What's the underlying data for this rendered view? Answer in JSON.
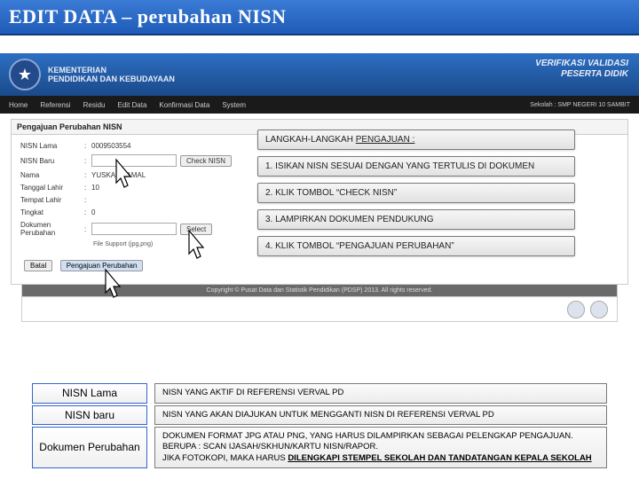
{
  "slide_title": "EDIT DATA – perubahan NISN",
  "gov": {
    "line1": "KEMENTERIAN",
    "line2": "PENDIDIKAN DAN KEBUDAYAAN",
    "verif1": "VERIFIKASI VALIDASI",
    "verif2": "PESERTA DIDIK"
  },
  "nav": {
    "items": [
      "Home",
      "Referensi",
      "Residu",
      "Edit Data",
      "Konfirmasi Data",
      "System"
    ],
    "sekolah": "Sekolah : SMP NEGERI 10 SAMBIT"
  },
  "panel": {
    "title": "Pengajuan Perubahan NISN",
    "rows": {
      "nisn_lama": {
        "label": "NISN Lama",
        "value": "0009503554"
      },
      "nisn_baru": {
        "label": "NISN Baru",
        "check": "Check NISN"
      },
      "nama": {
        "label": "Nama",
        "value": "YUSKANT AMAL"
      },
      "tanggal": {
        "label": "Tanggal Lahir",
        "value": "10"
      },
      "tempat": {
        "label": "Tempat Lahir",
        "value": ""
      },
      "tingkat": {
        "label": "Tingkat",
        "value": "0"
      },
      "dokumen": {
        "label": "Dokumen Perubahan",
        "select": "Select"
      },
      "file_support": "File Support (jpg,png)"
    },
    "batal": "Batal",
    "submit": "Pengajuan Perubahan"
  },
  "steps": {
    "header_a": "LANGKAH-LANGKAH ",
    "header_b": "PENGAJUAN :",
    "s1": "1. ISIKAN NISN SESUAI DENGAN YANG TERTULIS DI DOKUMEN",
    "s2": "2. KLIK TOMBOL “CHECK NISN”",
    "s3": "3. LAMPIRKAN DOKUMEN PENDUKUNG",
    "s4": "4. KLIK TOMBOL “PENGAJUAN PERUBAHAN”"
  },
  "copyright": "Copyright © Pusat Data dan Statistik Pendidikan (PDSP) 2013. All rights reserved.",
  "legend": {
    "l1": {
      "label": "NISN Lama",
      "desc": "NISN YANG AKTIF DI REFERENSI VERVAL PD"
    },
    "l2": {
      "label": "NISN baru",
      "desc": "NISN YANG AKAN DIAJUKAN UNTUK MENGGANTI NISN DI REFERENSI VERVAL PD"
    },
    "l3": {
      "label": "Dokumen Perubahan",
      "desc_line1": "DOKUMEN FORMAT JPG ATAU PNG, YANG HARUS DILAMPIRKAN SEBAGAI PELENGKAP PENGAJUAN.",
      "desc_line2": "BERUPA : SCAN IJASAH/SKHUN/KARTU NISN/RAPOR.",
      "desc_line3_a": "JIKA FOTOKOPI, MAKA HARUS ",
      "desc_line3_b": "DILENGKAPI STEMPEL SEKOLAH DAN TANDATANGAN KEPALA SEKOLAH"
    }
  }
}
